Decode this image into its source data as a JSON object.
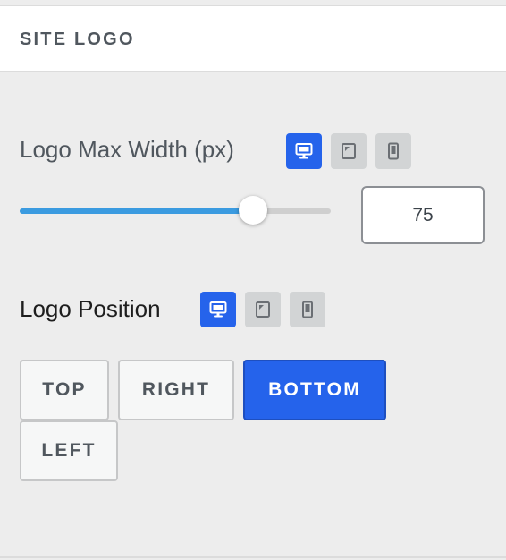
{
  "section": {
    "title": "SITE LOGO"
  },
  "max_width": {
    "label": "Logo Max Width (px)",
    "value": "75",
    "slider_fraction": 0.75,
    "devices": [
      "desktop-icon",
      "tablet-icon",
      "mobile-icon"
    ],
    "active_device": "desktop"
  },
  "position": {
    "label": "Logo Position",
    "devices": [
      "desktop-icon",
      "tablet-icon",
      "mobile-icon"
    ],
    "active_device": "desktop",
    "options": [
      "TOP",
      "RIGHT",
      "BOTTOM",
      "LEFT"
    ],
    "selected": "BOTTOM"
  },
  "colors": {
    "accent": "#2563eb",
    "slider_fill": "#3b9be0",
    "text": "#50575e",
    "panel_bg": "#ededed"
  }
}
